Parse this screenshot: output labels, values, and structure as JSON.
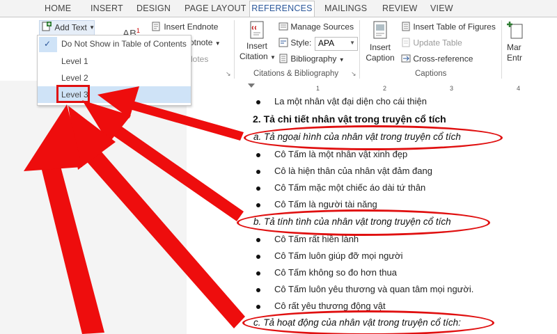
{
  "tabs": [
    "HOME",
    "INSERT",
    "DESIGN",
    "PAGE LAYOUT",
    "REFERENCES",
    "MAILINGS",
    "REVIEW",
    "VIEW"
  ],
  "active_tab": "REFERENCES",
  "ribbon": {
    "add_text": "Add Text",
    "ab_superscript": "1",
    "ab_label": "AB",
    "insert_endnote": "Insert Endnote",
    "next_footnote": "otnote",
    "show_notes": "lotes",
    "insert_citation_line1": "Insert",
    "insert_citation_line2": "Citation",
    "manage_sources": "Manage Sources",
    "style_label": "Style:",
    "style_value": "APA",
    "bibliography": "Bibliography",
    "group_citations": "Citations & Bibliography",
    "insert_caption_line1": "Insert",
    "insert_caption_line2": "Caption",
    "insert_table_of_figures": "Insert Table of Figures",
    "update_table": "Update Table",
    "cross_reference": "Cross-reference",
    "group_captions": "Captions",
    "mark_entry_line1": "Mar",
    "mark_entry_line2": "Entr"
  },
  "dropdown": {
    "items": [
      "Do Not Show in Table of Contents",
      "Level 1",
      "Level 2",
      "Level 3"
    ],
    "checked_index": 0,
    "highlighted_index": 3
  },
  "ruler": [
    "1",
    "2",
    "3",
    "4"
  ],
  "document": {
    "bullet_top": "La một nhân vật đại diện cho cái thiện",
    "heading2": "2. Tả chi tiết nhân vật trong truyện cổ tích",
    "sub_a": "a. Tả ngoại hình của nhân vật trong truyện cổ tích",
    "bullets_a": [
      "Cô Tấm là một nhân vật xinh đẹp",
      "Cô là hiện thân của nhân vật đảm đang",
      "Cô Tấm mặc một chiếc áo dài tứ thân",
      "Cô Tấm là người tài năng"
    ],
    "sub_b": "b. Tả tính tình của nhân vật trong truyện cổ tích",
    "bullets_b": [
      "Cô Tấm rất hiền lành",
      "Cô Tấm luôn giúp đỡ mọi người",
      "Cô Tấm không so đo hơn thua",
      "Cô Tấm luôn yêu thương và quan tâm mọi người.",
      "Cô rất yêu thương động vật"
    ],
    "sub_c": "c. Tả hoạt động của nhân vật trong truyện cổ tích:"
  },
  "colors": {
    "accent": "#2b579a",
    "annotation": "#e01010",
    "highlight": "#cfe3f7"
  }
}
